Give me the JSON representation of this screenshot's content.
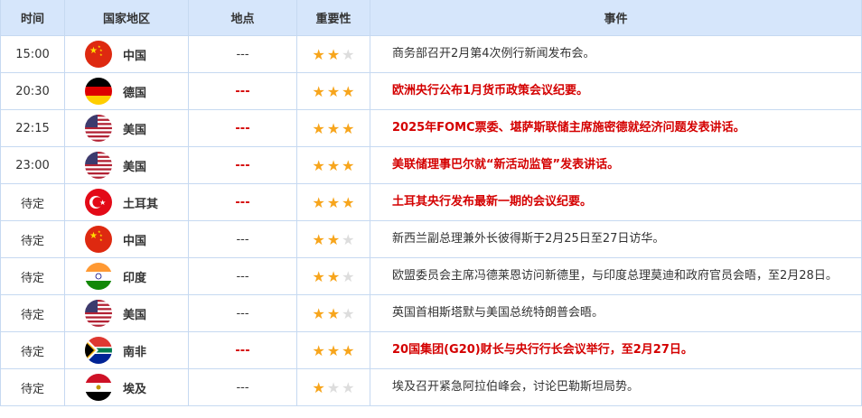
{
  "headers": [
    "时间",
    "国家地区",
    "地点",
    "重要性",
    "事件"
  ],
  "colors": {
    "header_bg": "#d6e6fb",
    "important": "#d40000",
    "star_on": "#f7a51c",
    "star_off": "#dddddd"
  },
  "rows": [
    {
      "time": "15:00",
      "country": "中国",
      "flag": "cn",
      "location": "---",
      "stars": 2,
      "important": false,
      "event": "商务部召开2月第4次例行新闻发布会。"
    },
    {
      "time": "20:30",
      "country": "德国",
      "flag": "de",
      "location": "---",
      "stars": 3,
      "important": true,
      "event": "欧洲央行公布1月货币政策会议纪要。"
    },
    {
      "time": "22:15",
      "country": "美国",
      "flag": "us",
      "location": "---",
      "stars": 3,
      "important": true,
      "event": "2025年FOMC票委、堪萨斯联储主席施密德就经济问题发表讲话。"
    },
    {
      "time": "23:00",
      "country": "美国",
      "flag": "us",
      "location": "---",
      "stars": 3,
      "important": true,
      "event": "美联储理事巴尔就“新活动监管”发表讲话。"
    },
    {
      "time": "待定",
      "country": "土耳其",
      "flag": "tr",
      "location": "---",
      "stars": 3,
      "important": true,
      "event": "土耳其央行发布最新一期的会议纪要。"
    },
    {
      "time": "待定",
      "country": "中国",
      "flag": "cn",
      "location": "---",
      "stars": 2,
      "important": false,
      "event": "新西兰副总理兼外长彼得斯于2月25日至27日访华。"
    },
    {
      "time": "待定",
      "country": "印度",
      "flag": "in",
      "location": "---",
      "stars": 2,
      "important": false,
      "event": "欧盟委员会主席冯德莱恩访问新德里，与印度总理莫迪和政府官员会晤，至2月28日。"
    },
    {
      "time": "待定",
      "country": "美国",
      "flag": "us",
      "location": "---",
      "stars": 2,
      "important": false,
      "event": "英国首相斯塔默与美国总统特朗普会晤。"
    },
    {
      "time": "待定",
      "country": "南非",
      "flag": "za",
      "location": "---",
      "stars": 3,
      "important": true,
      "event": "20国集团(G20)财长与央行行长会议举行，至2月27日。"
    },
    {
      "time": "待定",
      "country": "埃及",
      "flag": "eg",
      "location": "---",
      "stars": 1,
      "important": false,
      "event": "埃及召开紧急阿拉伯峰会，讨论巴勒斯坦局势。"
    }
  ]
}
